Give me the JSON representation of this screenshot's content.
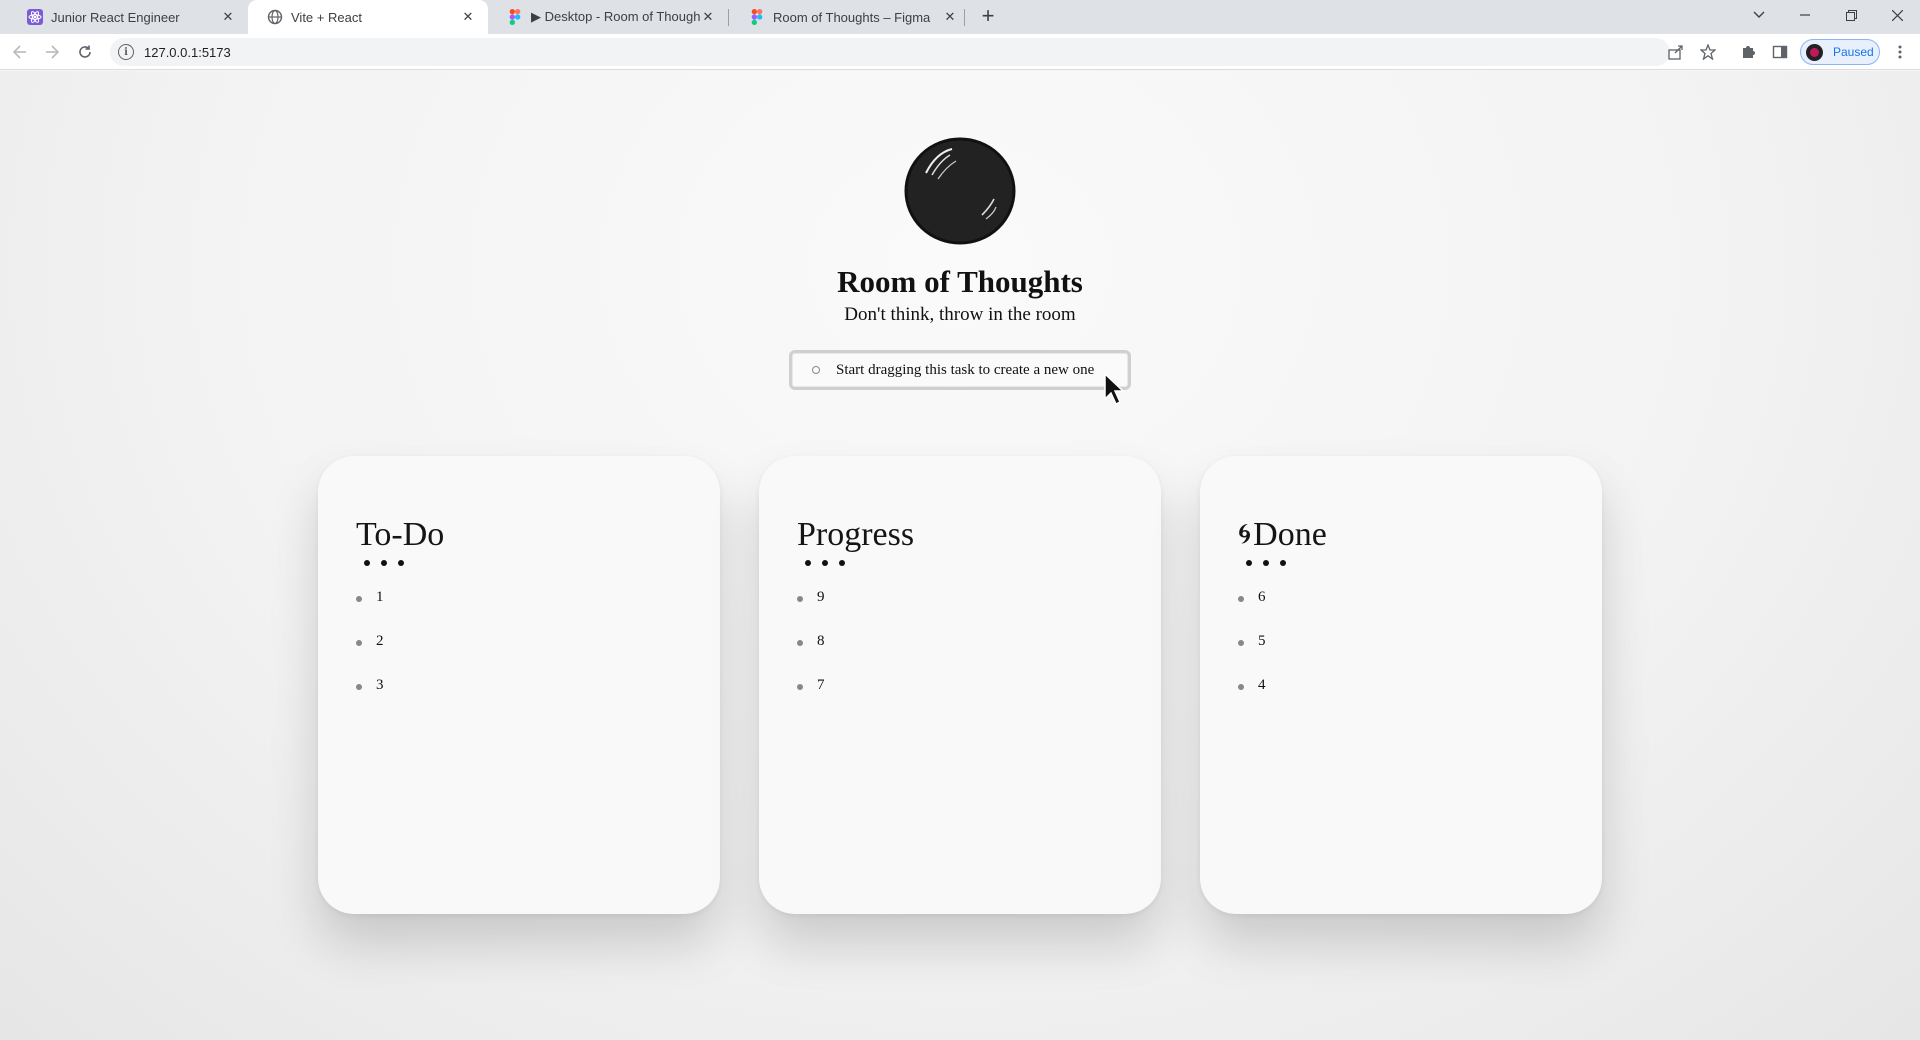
{
  "browser": {
    "tabs": [
      {
        "title": "Junior React Engineer",
        "icon": "react-app-icon",
        "active": false
      },
      {
        "title": "Vite + React",
        "icon": "globe-icon",
        "active": true
      },
      {
        "title": "▶ Desktop - Room of Thoughts",
        "icon": "figma-icon",
        "active": false
      },
      {
        "title": "Room of Thoughts – Figma",
        "icon": "figma-icon",
        "active": false
      }
    ],
    "url": "127.0.0.1:5173",
    "profile_label": "Paused"
  },
  "app": {
    "title": "Room of Thoughts",
    "subtitle": "Don't think, throw in the room",
    "drag_task": "Start dragging this task to create a new one"
  },
  "columns": [
    {
      "title": "To-Do",
      "items": [
        "1",
        "2",
        "3"
      ]
    },
    {
      "title": "Progress",
      "items": [
        "9",
        "8",
        "7"
      ]
    },
    {
      "title": "Done",
      "icon": "swirl-icon",
      "items": [
        "6",
        "5",
        "4"
      ]
    }
  ],
  "colors": {
    "accent": "#1a73e8",
    "logo": "#222222",
    "card": "#f9f9f9"
  }
}
